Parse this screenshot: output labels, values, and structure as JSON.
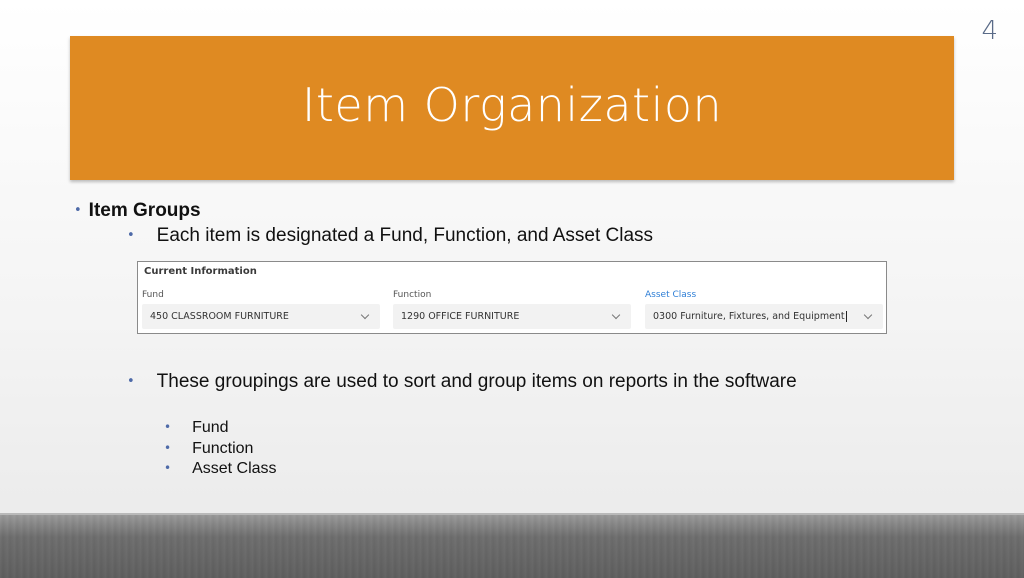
{
  "slide": {
    "number": "4",
    "title": "Item Organization"
  },
  "content": {
    "bullet_1": "Item Groups",
    "bullet_2": "Each item is designated a Fund, Function, and Asset Class",
    "bullet_3": "These groupings are used to sort and group items on reports in the software",
    "sub_items": [
      "Fund",
      "Function",
      "Asset Class"
    ]
  },
  "form": {
    "heading": "Current Information",
    "fields": [
      {
        "label": "Fund",
        "value": "450 CLASSROOM FURNITURE"
      },
      {
        "label": "Function",
        "value": "1290 OFFICE FURNITURE"
      },
      {
        "label": "Asset Class",
        "value": "0300 Furniture, Fixtures, and Equipment"
      }
    ]
  },
  "colors": {
    "title_band": "#df8a22",
    "bullet": "#4e6aa8",
    "active_label": "#2f7fd6"
  }
}
